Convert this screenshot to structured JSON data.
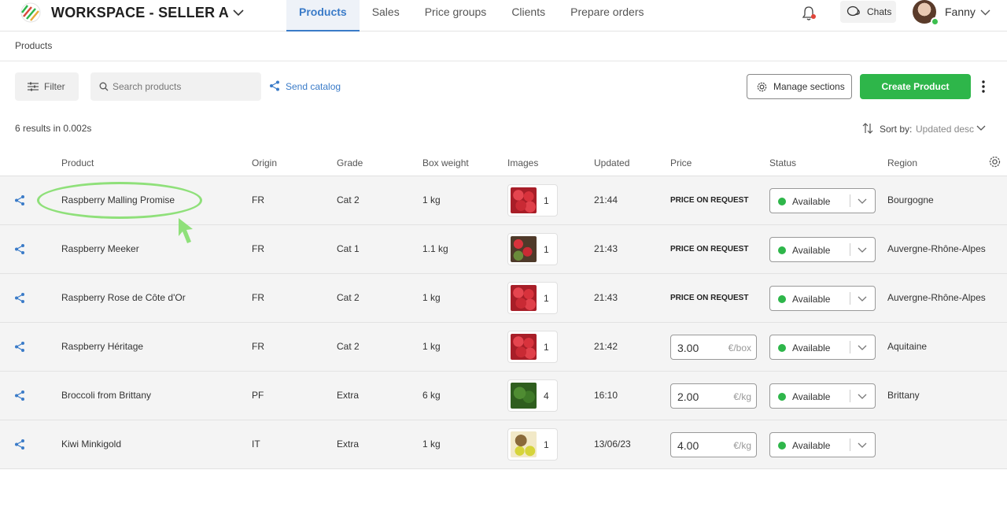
{
  "header": {
    "workspace": "WORKSPACE - SELLER A",
    "nav": [
      "Products",
      "Sales",
      "Price groups",
      "Clients",
      "Prepare orders"
    ],
    "active_nav": "Products",
    "chats_label": "Chats",
    "user_name": "Fanny"
  },
  "breadcrumb": "Products",
  "toolbar": {
    "filter_label": "Filter",
    "search_placeholder": "Search products",
    "send_catalog_label": "Send catalog",
    "manage_sections_label": "Manage sections",
    "create_product_label": "Create Product"
  },
  "results_text": "6 results in 0.002s",
  "sort": {
    "label": "Sort by:",
    "value": "Updated desc"
  },
  "table": {
    "columns": [
      "Product",
      "Origin",
      "Grade",
      "Box weight",
      "Images",
      "Updated",
      "Price",
      "Status",
      "Region"
    ],
    "rows": [
      {
        "product": "Raspberry Malling Promise",
        "origin": "FR",
        "grade": "Cat 2",
        "box_weight": "1 kg",
        "images": "1",
        "thumb": "raspberries",
        "updated": "21:44",
        "price_text": "PRICE ON REQUEST",
        "price_value": null,
        "price_unit": null,
        "status": "Available",
        "region": "Bourgogne"
      },
      {
        "product": "Raspberry Meeker",
        "origin": "FR",
        "grade": "Cat 1",
        "box_weight": "1.1 kg",
        "images": "1",
        "thumb": "raspberry-plant",
        "updated": "21:43",
        "price_text": "PRICE ON REQUEST",
        "price_value": null,
        "price_unit": null,
        "status": "Available",
        "region": "Auvergne-Rhône-Alpes"
      },
      {
        "product": "Raspberry Rose de Côte d'Or",
        "origin": "FR",
        "grade": "Cat 2",
        "box_weight": "1 kg",
        "images": "1",
        "thumb": "raspberries",
        "updated": "21:43",
        "price_text": "PRICE ON REQUEST",
        "price_value": null,
        "price_unit": null,
        "status": "Available",
        "region": "Auvergne-Rhône-Alpes"
      },
      {
        "product": "Raspberry Héritage",
        "origin": "FR",
        "grade": "Cat 2",
        "box_weight": "1 kg",
        "images": "1",
        "thumb": "raspberries",
        "updated": "21:42",
        "price_text": null,
        "price_value": "3.00",
        "price_unit": "€/box",
        "status": "Available",
        "region": "Aquitaine"
      },
      {
        "product": "Broccoli from Brittany",
        "origin": "PF",
        "grade": "Extra",
        "box_weight": "6 kg",
        "images": "4",
        "thumb": "broccoli",
        "updated": "16:10",
        "price_text": null,
        "price_value": "2.00",
        "price_unit": "€/kg",
        "status": "Available",
        "region": "Brittany"
      },
      {
        "product": "Kiwi Minkigold",
        "origin": "IT",
        "grade": "Extra",
        "box_weight": "1 kg",
        "images": "1",
        "thumb": "kiwi",
        "updated": "13/06/23",
        "price_text": null,
        "price_value": "4.00",
        "price_unit": "€/kg",
        "status": "Available",
        "region": ""
      }
    ]
  },
  "colors": {
    "accent": "#3a7bc8",
    "primary_button": "#2eb64a",
    "status_available": "#2eb64a",
    "highlight": "#8fe07a"
  }
}
